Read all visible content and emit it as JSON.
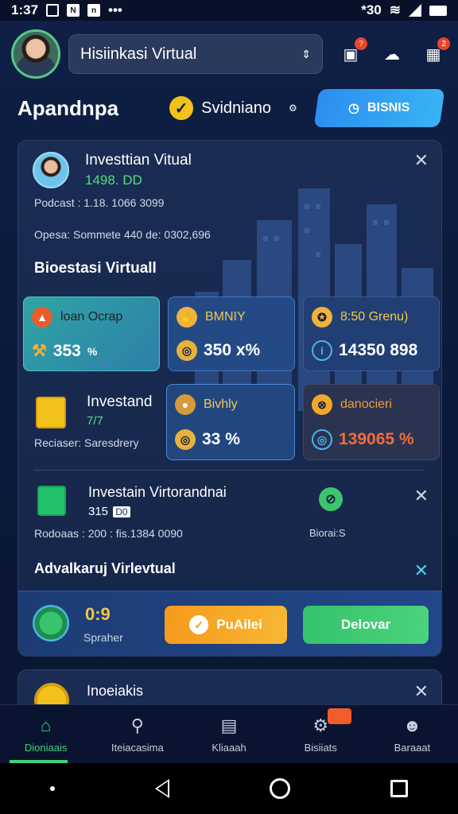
{
  "status_bar": {
    "time": "1:37",
    "right_text": "*30"
  },
  "header": {
    "app_selector": "Hisiinkasi Virtual",
    "notification_badge": "?",
    "store_badge": "2"
  },
  "title_row": {
    "page_title": "Apandnpa",
    "status_label": "Svidniano",
    "bisnis_button": "BISNIS"
  },
  "main_card": {
    "investment": {
      "title": "Investtian Vitual",
      "value": "1498. DD",
      "meta_1": "Podcast : 1.18. 1066 3099",
      "meta_2": "Opesa: Sommete 440 de: 0302,696"
    },
    "section_title": "Bioestasi Virtuall",
    "tiles_row1": [
      {
        "label": "loan Ocrap",
        "value": "353",
        "unit": "%"
      },
      {
        "label": "BMNIY",
        "value": "350 x%"
      },
      {
        "label": "8:50 Grenu)",
        "value": "14350 898"
      }
    ],
    "row2": {
      "title": "Investand",
      "sub_value": "7/7",
      "meta": "Reciaser: Saresdrery",
      "tile_mid": {
        "label": "Bivhly",
        "value": "33 %"
      },
      "tile_right": {
        "label": "danocieri",
        "value": "139065 %"
      }
    },
    "row3": {
      "title": "Investain Virtorandnai",
      "value": "315",
      "badge": "D0",
      "meta": "Rodoaas : 200 : fis.1384 0090",
      "side_label": "Biorai:S"
    },
    "advisory_title": "Advalkaruj Virlevtual",
    "action": {
      "timer": "0:9",
      "timer_label": "Spraher",
      "primary_button": "PuAilei",
      "secondary_button": "Delovar"
    }
  },
  "peek_card": {
    "title": "Inoeiakis"
  },
  "bottom_nav": [
    {
      "label": "Dioniaais",
      "icon": "home-icon"
    },
    {
      "label": "Iteiacasima",
      "icon": "search-icon"
    },
    {
      "label": "Kliaaah",
      "icon": "document-icon"
    },
    {
      "label": "Bisiiats",
      "icon": "gear-icon"
    },
    {
      "label": "Baraaat",
      "icon": "user-icon"
    }
  ],
  "colors": {
    "accent_green": "#3fd27a",
    "accent_blue": "#2c8ef0",
    "accent_orange": "#f69a1c",
    "background": "#0b1733"
  }
}
